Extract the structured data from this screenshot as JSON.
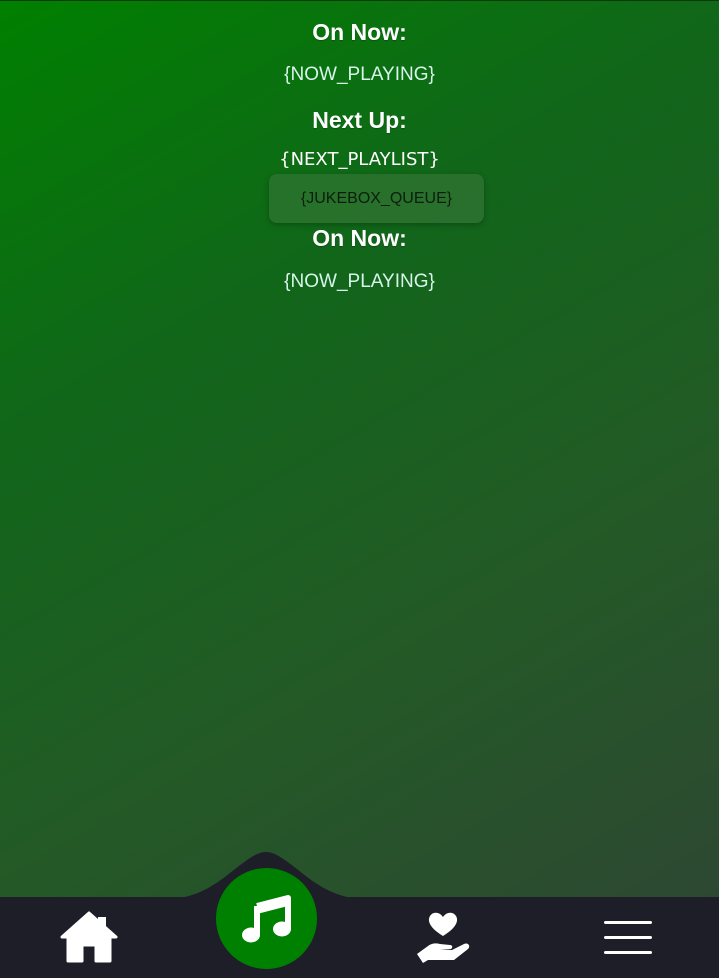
{
  "now_playing_section": {
    "heading": "On Now:",
    "value": "{NOW_PLAYING}"
  },
  "next_up_section": {
    "heading": "Next Up:",
    "value": "{NEXT_PLAYLIST}"
  },
  "jukebox_queue": {
    "value": "{JUKEBOX_QUEUE}"
  },
  "now_playing_section_2": {
    "heading": "On Now:",
    "value": "{NOW_PLAYING}"
  },
  "bottom_nav": {
    "items": [
      {
        "icon": "home-icon"
      },
      {
        "icon": "music-note-icon",
        "active": true
      },
      {
        "icon": "hand-heart-icon"
      },
      {
        "icon": "hamburger-menu-icon"
      }
    ],
    "background_color": "#1e1e28",
    "active_color": "#008000"
  },
  "colors": {
    "gradient_start": "#008000",
    "gradient_end": "#2f4534",
    "heading_text": "#ffffff",
    "value_text": "#d7f5ea"
  }
}
